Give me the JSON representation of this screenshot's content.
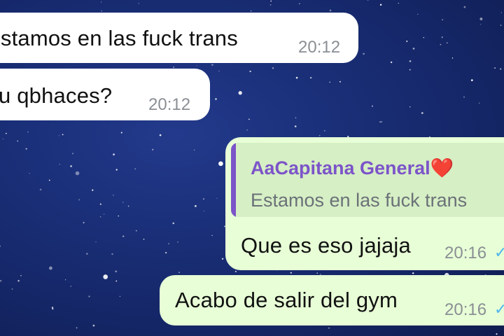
{
  "conversation": {
    "messages": [
      {
        "direction": "incoming",
        "text": "Estamos en las fuck trans",
        "time": "20:12"
      },
      {
        "direction": "incoming",
        "text": "Tu qbhaces?",
        "time": "20:12"
      },
      {
        "direction": "outgoing",
        "reply_to": {
          "author": "AaCapitana General",
          "author_emoji": "❤️",
          "text": "Estamos en las fuck trans"
        },
        "text": "Que es eso jajaja",
        "time": "20:16",
        "status_icon": "double-check-icon",
        "status_glyph": "✓✓"
      },
      {
        "direction": "outgoing",
        "text": "Acabo de salir del gym",
        "time": "20:16",
        "status_icon": "double-check-icon",
        "status_glyph": "✓✓"
      }
    ]
  },
  "colors": {
    "wallpaper": "#1a2f78",
    "incoming_bubble": "#ffffff",
    "outgoing_bubble": "#e7fed6",
    "quote_accent": "#7c54c9",
    "read_ticks": "#4fb6ec",
    "heart": "#e0202a"
  }
}
